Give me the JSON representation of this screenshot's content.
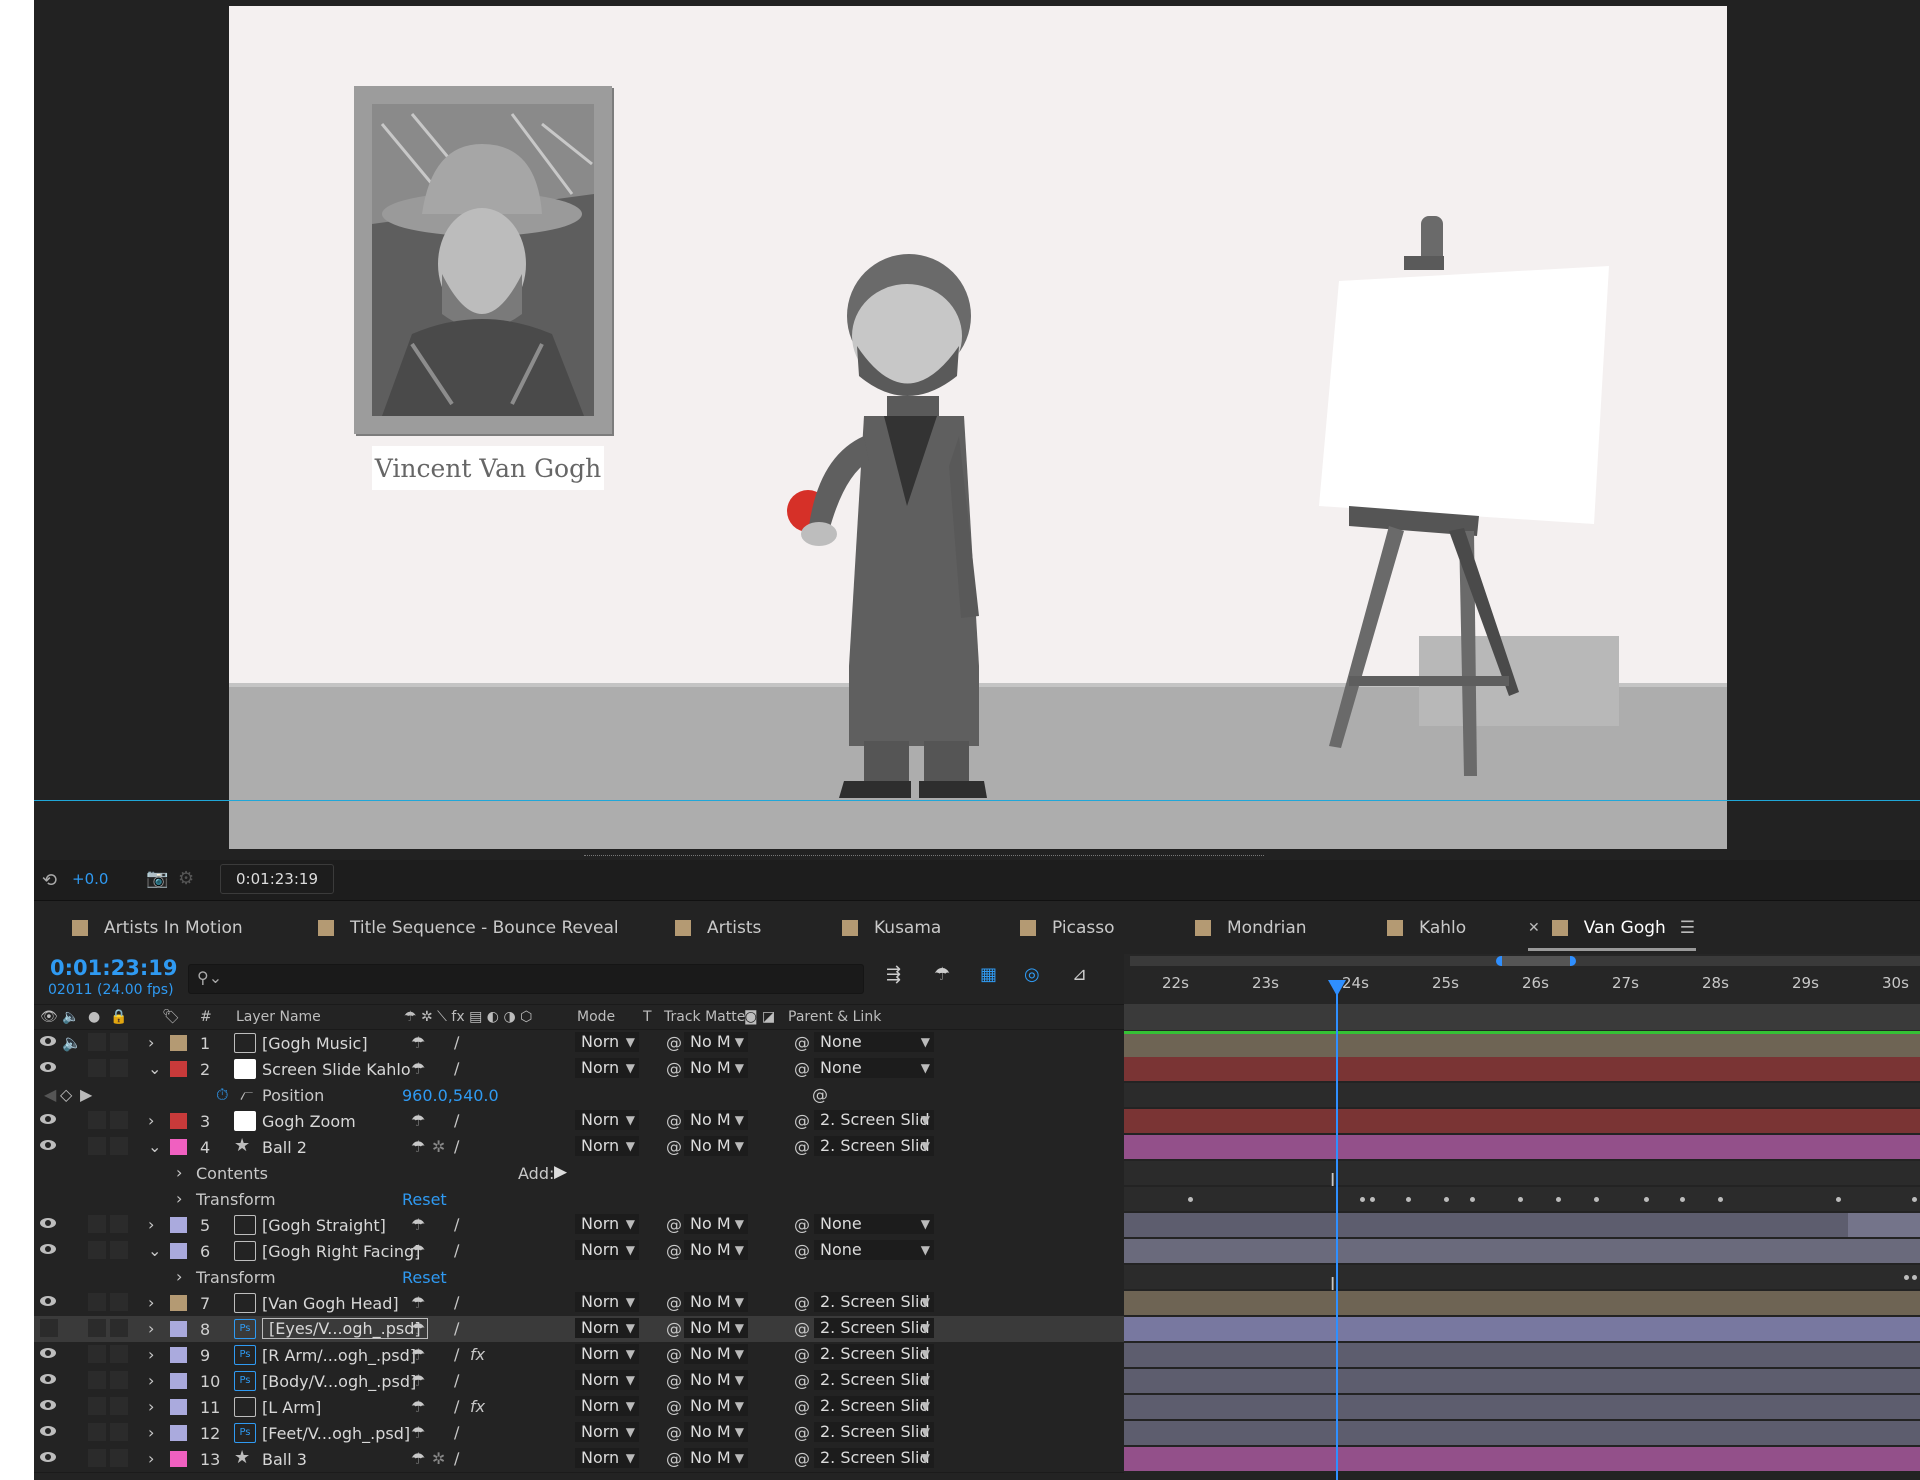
{
  "viewer": {
    "caption": "Vincent Van Gogh"
  },
  "toolbar": {
    "exposure": "+0.0",
    "timecode": "0:01:23:19"
  },
  "tabs": [
    {
      "label": "Artists In Motion",
      "color": "#b49a73"
    },
    {
      "label": "Title Sequence - Bounce Reveal",
      "color": "#b49a73"
    },
    {
      "label": "Artists",
      "color": "#b49a73"
    },
    {
      "label": "Kusama",
      "color": "#b49a73"
    },
    {
      "label": "Picasso",
      "color": "#b49a73"
    },
    {
      "label": "Mondrian",
      "color": "#b49a73"
    },
    {
      "label": "Kahlo",
      "color": "#b49a73"
    },
    {
      "label": "Van Gogh",
      "color": "#b49a73",
      "active": true
    }
  ],
  "timeline": {
    "current_time": "0:01:23:19",
    "frame_fps": "02011 (24.00 fps)",
    "search_placeholder": "",
    "ticks": [
      "22s",
      "23s",
      "24s",
      "25s",
      "26s",
      "27s",
      "28s",
      "29s",
      "30s"
    ],
    "headers": {
      "num": "#",
      "layer_name": "Layer Name",
      "mode": "Mode",
      "t": "T",
      "track_matte": "Track Matte",
      "parent": "Parent & Link"
    }
  },
  "layers": {
    "l1": {
      "num": "1",
      "name": "[Gogh Music]",
      "mode": "Norn",
      "matte": "No M",
      "parent": "None",
      "label": "#b49a73",
      "bar": "#6e6454"
    },
    "l2": {
      "num": "2",
      "name": "Screen Slide Kahlo",
      "mode": "Norn",
      "matte": "No M",
      "parent": "None",
      "label": "#c83a3a",
      "bar": "#7a3434"
    },
    "l2_position": {
      "label": "Position",
      "value": "960.0,540.0"
    },
    "l3": {
      "num": "3",
      "name": "Gogh Zoom",
      "mode": "Norn",
      "matte": "No M",
      "parent": "2. Screen Slid",
      "label": "#c83a3a",
      "bar": "#7a3434"
    },
    "l4": {
      "num": "4",
      "name": "Ball 2",
      "mode": "Norn",
      "matte": "No M",
      "parent": "2. Screen Slid",
      "label": "#f060c0",
      "bar": "#93508a"
    },
    "l4_contents": {
      "label": "Contents",
      "add": "Add:"
    },
    "l4_transform": {
      "label": "Transform",
      "reset": "Reset"
    },
    "l5": {
      "num": "5",
      "name": "[Gogh Straight]",
      "mode": "Norn",
      "matte": "No M",
      "parent": "None",
      "label": "#aaaadd",
      "bar": "#5d5d6e"
    },
    "l6": {
      "num": "6",
      "name": "[Gogh Right Facing]",
      "mode": "Norn",
      "matte": "No M",
      "parent": "None",
      "label": "#aaaadd",
      "bar": "#6a6a7c"
    },
    "l6_transform": {
      "label": "Transform",
      "reset": "Reset"
    },
    "l7": {
      "num": "7",
      "name": "[Van Gogh Head]",
      "mode": "Norn",
      "matte": "No M",
      "parent": "2. Screen Slid",
      "label": "#b49a73",
      "bar": "#6e6454"
    },
    "l8": {
      "num": "8",
      "name": "[Eyes/V...ogh_.psd]",
      "mode": "Norn",
      "matte": "No M",
      "parent": "2. Screen Slid",
      "label": "#aaaadd",
      "bar": "#7878a0"
    },
    "l9": {
      "num": "9",
      "name": "[R Arm/...ogh_.psd]",
      "mode": "Norn",
      "matte": "No M",
      "parent": "2. Screen Slid",
      "label": "#aaaadd",
      "bar": "#5d5d6e"
    },
    "l10": {
      "num": "10",
      "name": "[Body/V...ogh_.psd]",
      "mode": "Norn",
      "matte": "No M",
      "parent": "2. Screen Slid",
      "label": "#aaaadd",
      "bar": "#5d5d6e"
    },
    "l11": {
      "num": "11",
      "name": "[L Arm]",
      "mode": "Norn",
      "matte": "No M",
      "parent": "2. Screen Slid",
      "label": "#aaaadd",
      "bar": "#5d5d6e"
    },
    "l12": {
      "num": "12",
      "name": "[Feet/V...ogh_.psd]",
      "mode": "Norn",
      "matte": "No M",
      "parent": "2. Screen Slid",
      "label": "#aaaadd",
      "bar": "#5d5d6e"
    },
    "l13": {
      "num": "13",
      "name": "Ball 3",
      "mode": "Norn",
      "matte": "No M",
      "parent": "2. Screen Slid",
      "label": "#f060c0",
      "bar": "#93508a"
    }
  }
}
